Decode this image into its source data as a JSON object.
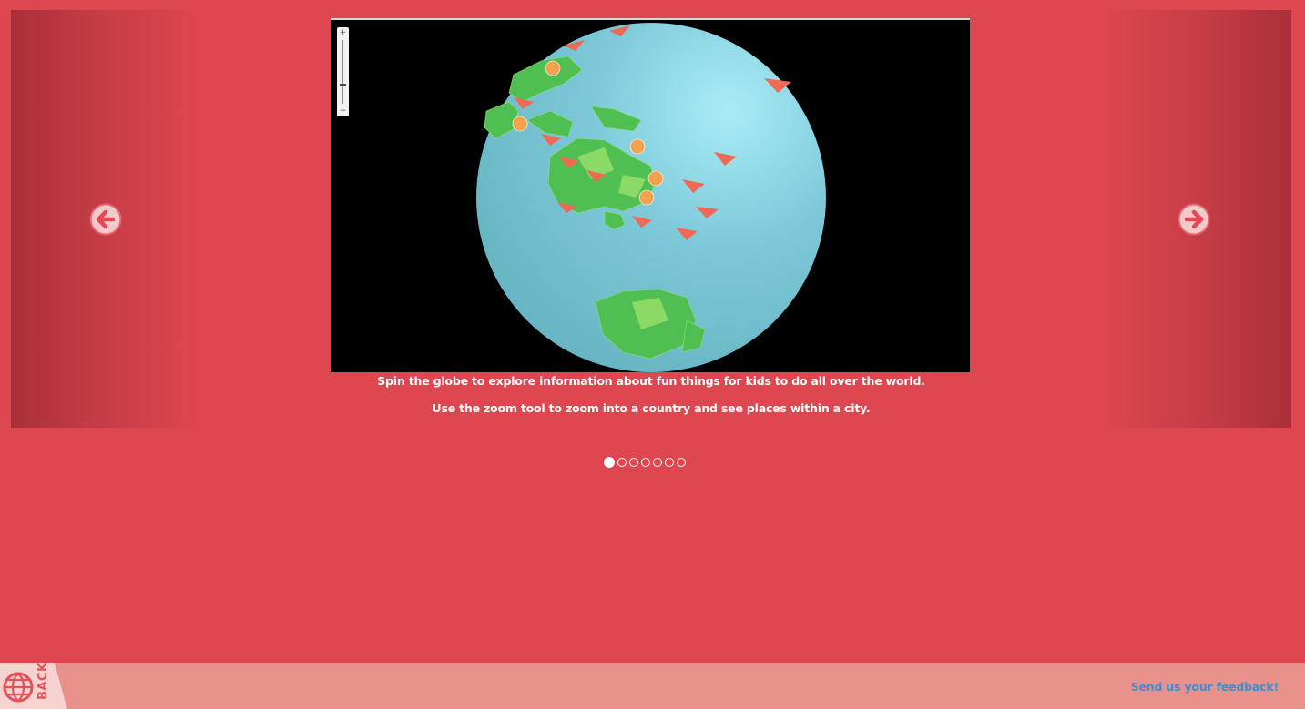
{
  "slideshow": {
    "caption_line_1": "Spin the globe to explore information about fun things for kids to do all over the world.",
    "caption_line_2": "Use the zoom tool to zoom into a country and see places within a city.",
    "slide_count": 7,
    "active_slide": 1,
    "prev_icon": "arrow-left-circle-icon",
    "next_icon": "arrow-right-circle-icon"
  },
  "footer": {
    "back_label": "BACK",
    "back_icon": "globe-icon",
    "feedback_label": "Send us your feedback!"
  },
  "colors": {
    "background": "#de4650",
    "footer": "#e8908a",
    "link": "#3d8fd1"
  }
}
